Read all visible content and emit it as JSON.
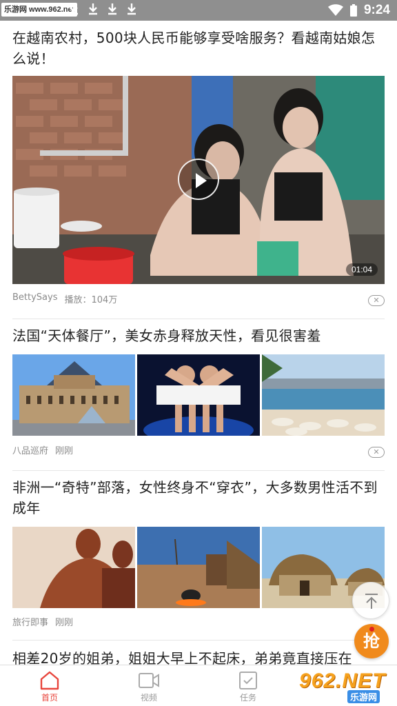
{
  "status_bar": {
    "watermark": "乐游网 www.962.net",
    "time": "9:24",
    "download_icons": [
      "download-icon",
      "download-icon",
      "download-icon",
      "download-icon"
    ],
    "wifi_icon": "wifi-icon",
    "battery_icon": "battery-icon"
  },
  "feed": [
    {
      "title": "在越南农村，500块人民币能够享受啥服务？看越南姑娘怎么说！",
      "source": "BettySays",
      "plays": "播放：104万",
      "duration": "01:04",
      "type": "video"
    },
    {
      "title": "法国“天体餐厅”，美女赤身释放天性，看见很害羞",
      "source": "八品巡府",
      "time": "刚刚",
      "type": "three-image"
    },
    {
      "title": "非洲一“奇特”部落，女性终身不“穿衣”，大多数男性活不到成年",
      "source": "旅行即事",
      "time": "刚刚",
      "type": "three-image"
    },
    {
      "title": "相差20岁的姐弟，姐姐大早上不起床，弟弟竟直接压在",
      "type": "partial"
    }
  ],
  "floating": {
    "back_to_top_icon": "arrow-up-icon",
    "grab_label": "抢"
  },
  "bottom_nav": {
    "items": [
      {
        "label": "首页",
        "icon": "home-icon",
        "active": true
      },
      {
        "label": "视频",
        "icon": "video-icon",
        "active": false
      },
      {
        "label": "任务",
        "icon": "task-icon",
        "active": false
      }
    ],
    "watermark_num": "962.NET",
    "watermark_cn": "乐游网"
  },
  "colors": {
    "accent": "#e8453c",
    "status_bar": "#8f8f8f",
    "grab_button": "#f08a1c"
  }
}
